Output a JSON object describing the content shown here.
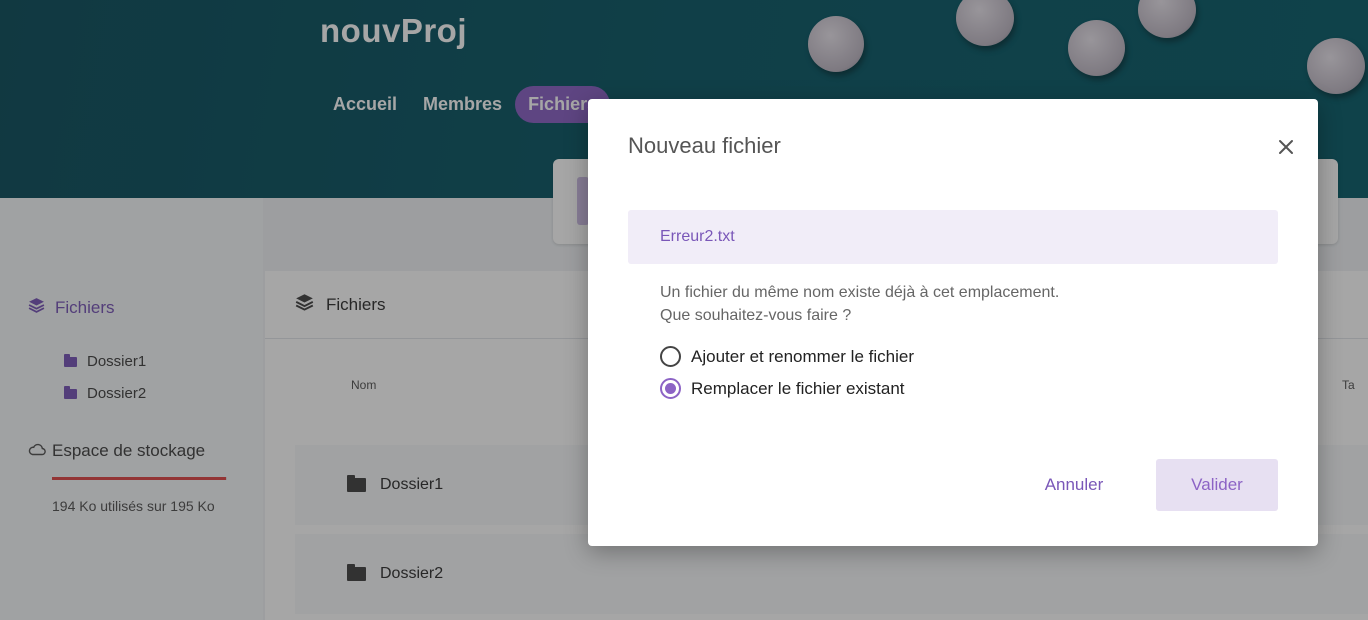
{
  "app": {
    "project_title": "nouvProj"
  },
  "nav": {
    "items": [
      {
        "label": "Accueil",
        "active": false
      },
      {
        "label": "Membres",
        "active": false
      },
      {
        "label": "Fichiers",
        "active": true
      }
    ]
  },
  "sidebar": {
    "section_label": "Fichiers",
    "folders": [
      {
        "label": "Dossier1"
      },
      {
        "label": "Dossier2"
      }
    ],
    "storage": {
      "label": "Espace de stockage",
      "usage_text": "194 Ko utilisés sur 195 Ko",
      "used_fraction": 0.995,
      "bar_color": "#e04949"
    }
  },
  "main": {
    "header_label": "Fichiers",
    "columns": {
      "name": "Nom",
      "right_truncated": "Ta"
    },
    "rows": [
      {
        "name": "Dossier1"
      },
      {
        "name": "Dossier2"
      }
    ]
  },
  "modal": {
    "title": "Nouveau fichier",
    "filename": "Erreur2.txt",
    "message_line1": "Un fichier du même nom existe déjà à cet emplacement.",
    "message_line2": "Que souhaitez-vous faire ?",
    "options": [
      {
        "label": "Ajouter et renommer le fichier",
        "checked": false
      },
      {
        "label": "Remplacer le fichier existant",
        "checked": true
      }
    ],
    "cancel_label": "Annuler",
    "confirm_label": "Valider"
  },
  "colors": {
    "accent": "#8c63c5",
    "banner": "#0d5a68",
    "danger": "#e04949"
  }
}
